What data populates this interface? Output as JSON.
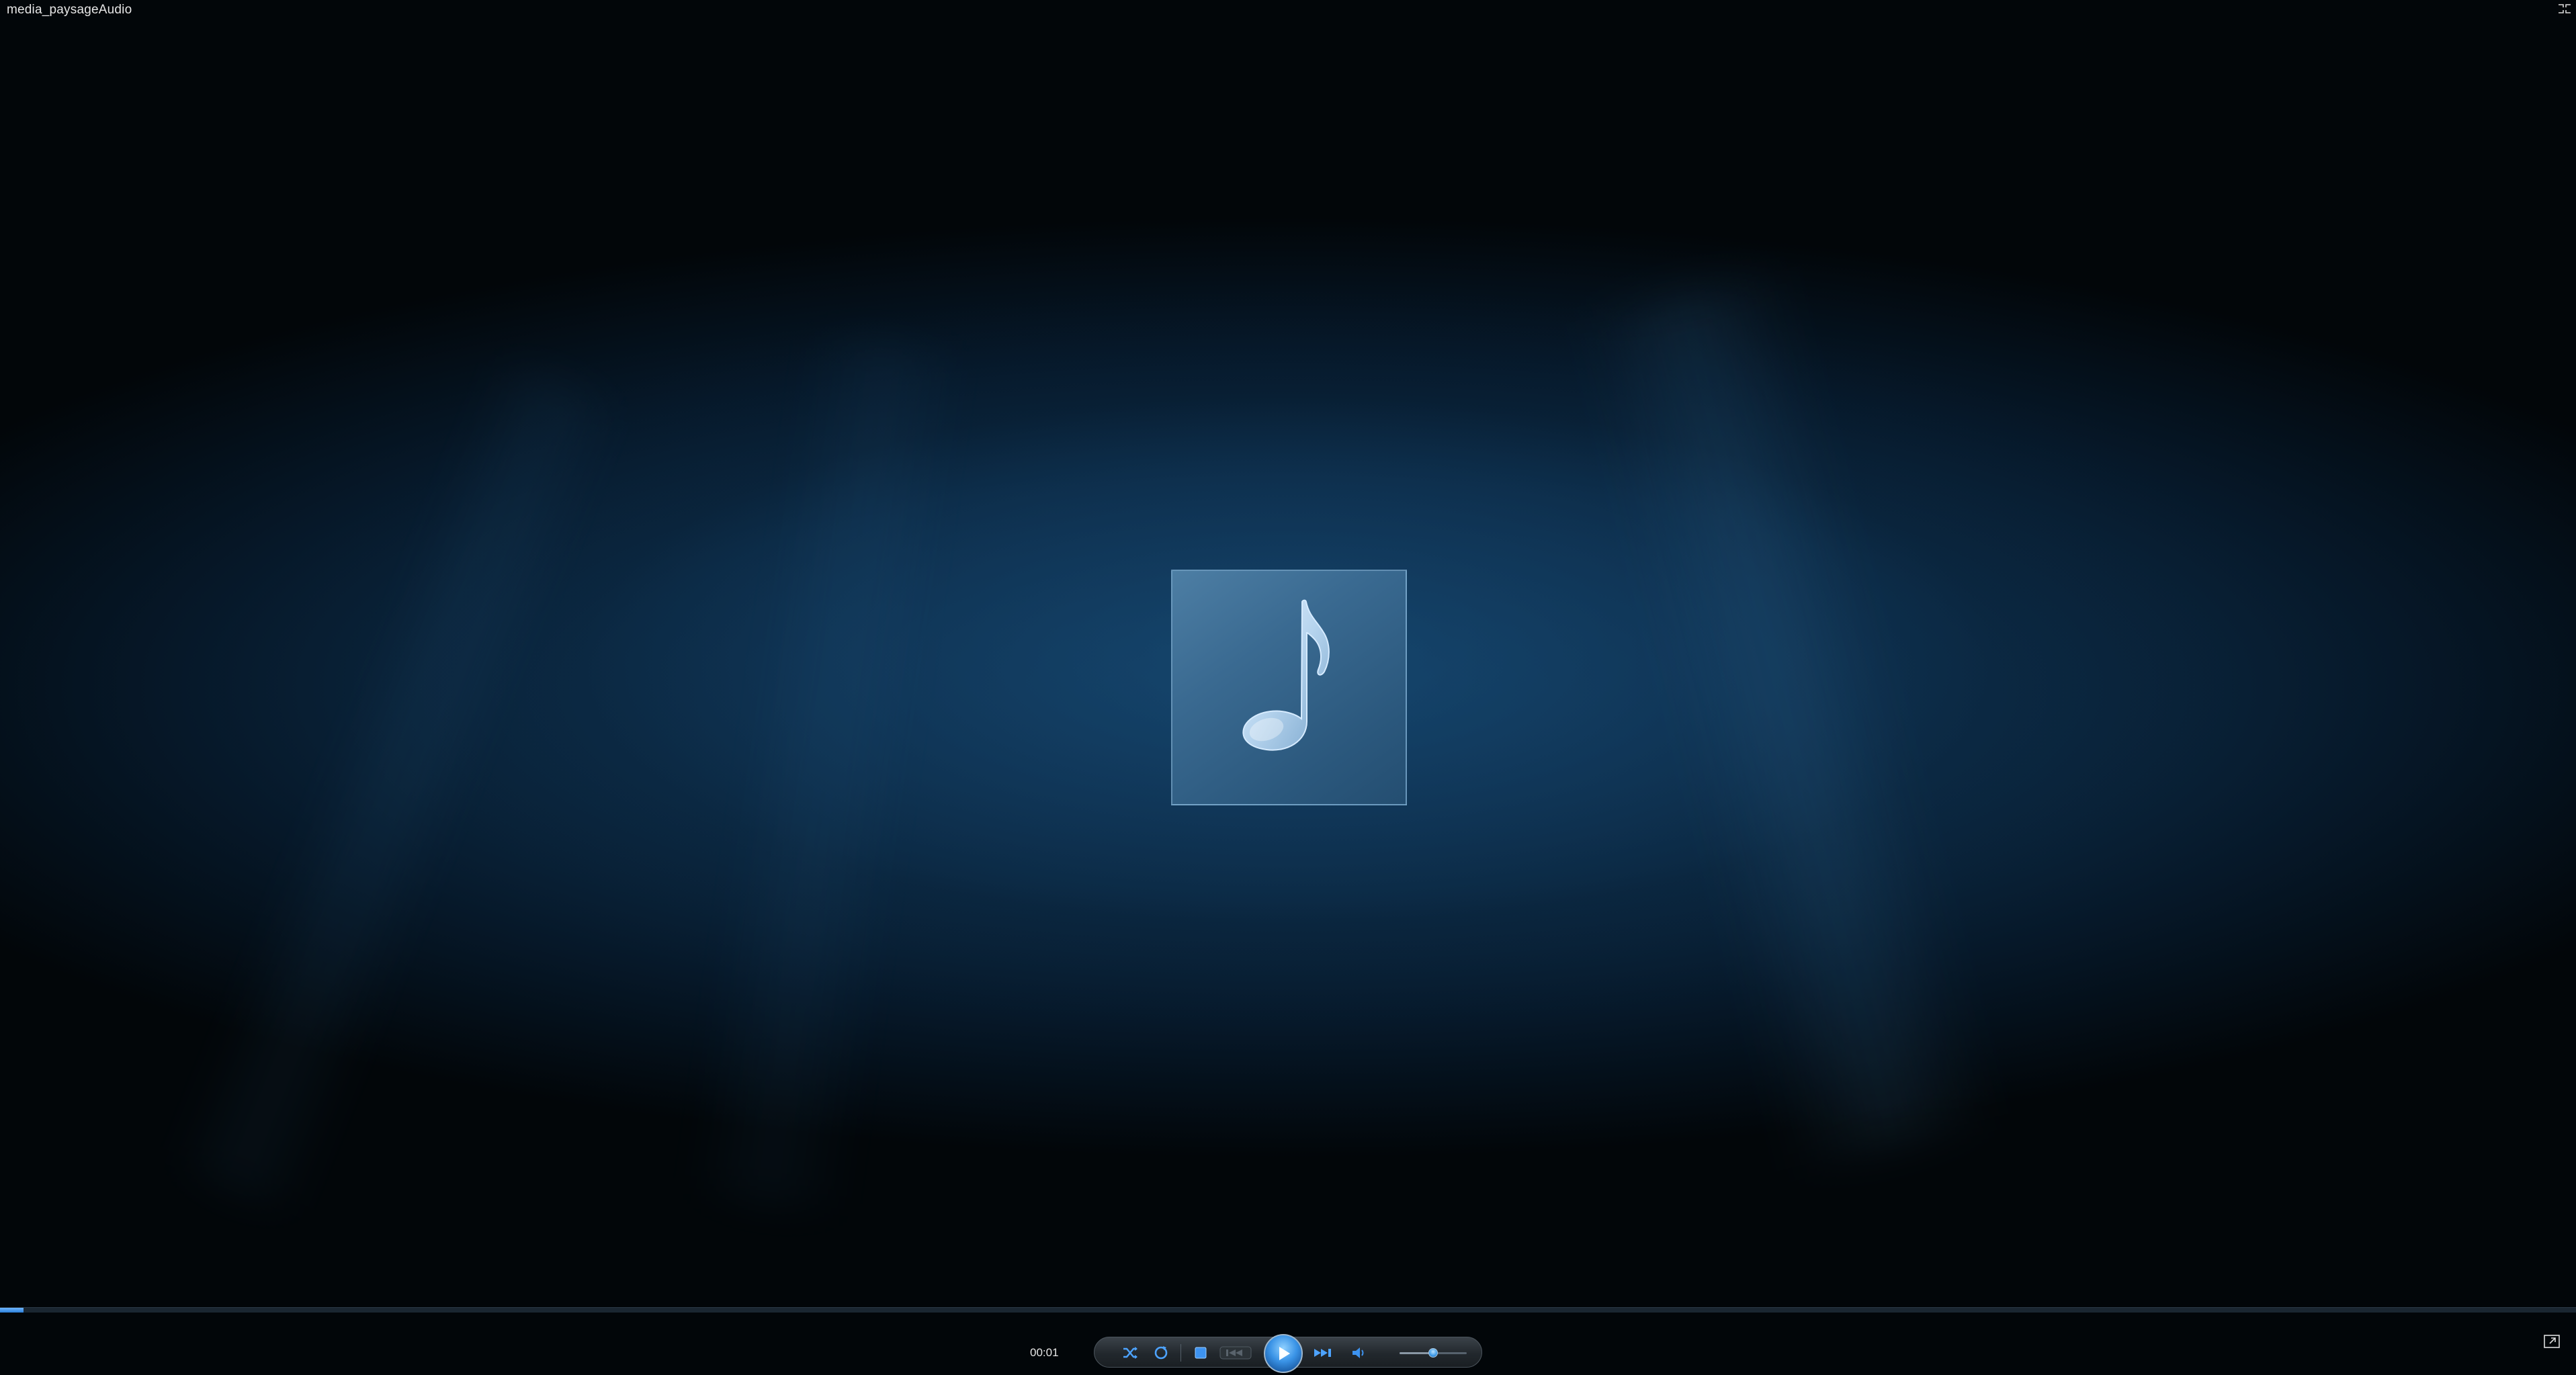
{
  "window": {
    "title": "media_paysageAudio"
  },
  "playback": {
    "elapsed": "00:01",
    "progress_fraction": 0.009,
    "volume_fraction": 0.5
  },
  "icons": {
    "album_art": "music-note-icon",
    "shuffle": "shuffle-icon",
    "repeat": "repeat-icon",
    "stop": "stop-icon",
    "previous": "previous-icon",
    "play": "play-icon",
    "next": "next-icon",
    "mute": "speaker-icon",
    "switch_to_library": "switch-to-library-icon",
    "fullscreen_toggle": "exit-fullscreen-icon"
  },
  "colors": {
    "accent": "#3a93e6",
    "background": "#0c2b46",
    "text": "#e6e6e6"
  }
}
